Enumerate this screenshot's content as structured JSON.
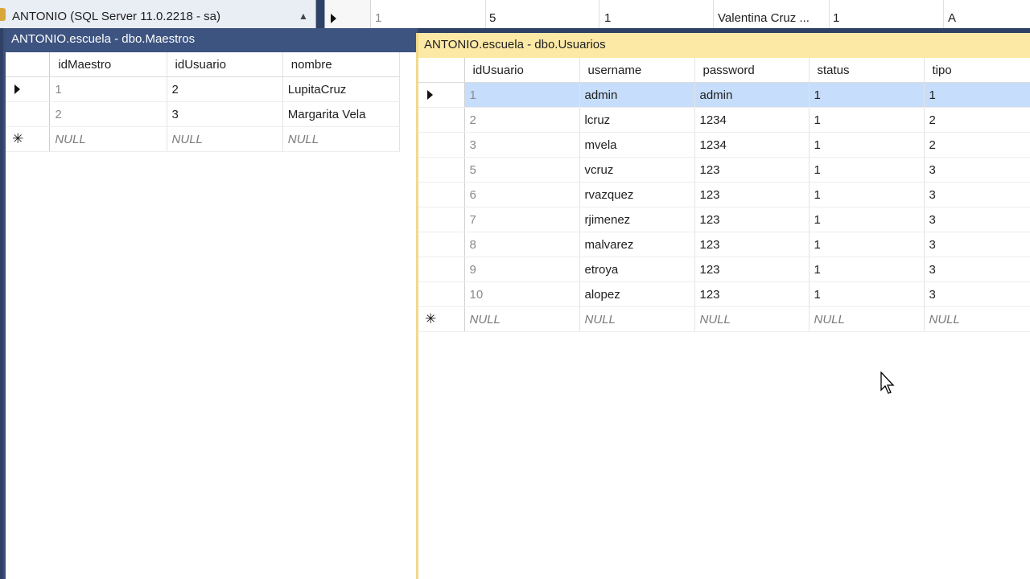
{
  "object_explorer": {
    "server_node_label": "ANTONIO (SQL Server 11.0.2218 - sa)"
  },
  "background_grid": {
    "row": [
      "1",
      "5",
      "1",
      "Valentina Cruz ...",
      "1",
      "A"
    ]
  },
  "maestros_window": {
    "title": "ANTONIO.escuela - dbo.Maestros",
    "columns": [
      "idMaestro",
      "idUsuario",
      "nombre"
    ],
    "rows": [
      [
        "1",
        "2",
        "LupitaCruz"
      ],
      [
        "2",
        "3",
        "Margarita Vela"
      ]
    ],
    "new_row": [
      "NULL",
      "NULL",
      "NULL"
    ]
  },
  "usuarios_window": {
    "title": "ANTONIO.escuela - dbo.Usuarios",
    "columns": [
      "idUsuario",
      "username",
      "password",
      "status",
      "tipo"
    ],
    "rows": [
      [
        "1",
        "admin",
        "admin",
        "1",
        "1"
      ],
      [
        "2",
        "lcruz",
        "1234",
        "1",
        "2"
      ],
      [
        "3",
        "mvela",
        "1234",
        "1",
        "2"
      ],
      [
        "5",
        "vcruz",
        "123",
        "1",
        "3"
      ],
      [
        "6",
        "rvazquez",
        "123",
        "1",
        "3"
      ],
      [
        "7",
        "rjimenez",
        "123",
        "1",
        "3"
      ],
      [
        "8",
        "malvarez",
        "123",
        "1",
        "3"
      ],
      [
        "9",
        "etroya",
        "123",
        "1",
        "3"
      ],
      [
        "10",
        "alopez",
        "123",
        "1",
        "3"
      ]
    ],
    "new_row": [
      "NULL",
      "NULL",
      "NULL",
      "NULL",
      "NULL"
    ]
  },
  "colors": {
    "active_tab": "#fde9a6",
    "inactive_tab": "#3d5380",
    "selected_row": "#c6ddfb"
  }
}
